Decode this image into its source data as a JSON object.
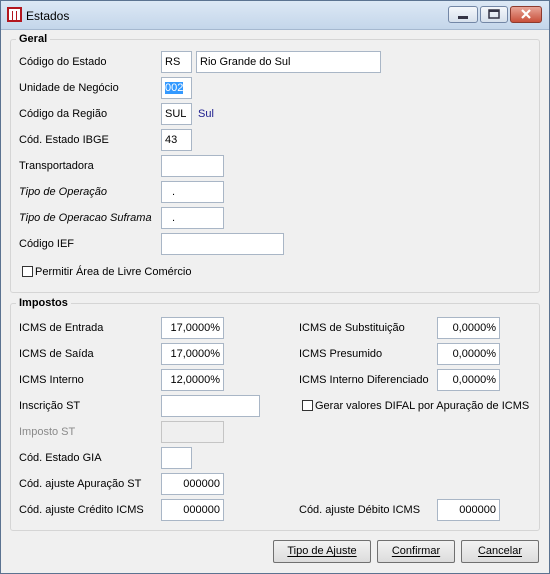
{
  "window": {
    "title": "Estados"
  },
  "geral": {
    "title": "Geral",
    "codigo_estado": {
      "label": "Código do Estado",
      "value": "RS",
      "name": "Rio Grande do Sul"
    },
    "unidade_negocio": {
      "label": "Unidade de Negócio",
      "value": "002"
    },
    "codigo_regiao": {
      "label": "Código da Região",
      "value": "SUL",
      "name": "Sul"
    },
    "cod_estado_ibge": {
      "label": "Cód. Estado IBGE",
      "value": "43"
    },
    "transportadora": {
      "label": "Transportadora",
      "value": ""
    },
    "tipo_operacao": {
      "label": "Tipo de Operação",
      "value": "."
    },
    "tipo_operacao_suframa": {
      "label": "Tipo de Operacao Suframa",
      "value": "."
    },
    "codigo_ief": {
      "label": "Código IEF",
      "value": ""
    },
    "livre_comercio": {
      "label": "Permitir Área de Livre Comércio",
      "checked": false
    }
  },
  "impostos": {
    "title": "Impostos",
    "icms_entrada": {
      "label": "ICMS de Entrada",
      "value": "17,0000%"
    },
    "icms_saida": {
      "label": "ICMS de Saída",
      "value": "17,0000%"
    },
    "icms_interno": {
      "label": "ICMS Interno",
      "value": "12,0000%"
    },
    "inscricao_st": {
      "label": "Inscrição ST",
      "value": ""
    },
    "imposto_st": {
      "label": "Imposto ST",
      "value": ""
    },
    "cod_estado_gia": {
      "label": "Cód. Estado GIA",
      "value": ""
    },
    "cod_ajuste_apuracao_st": {
      "label": "Cód. ajuste Apuração ST",
      "value": "000000"
    },
    "cod_ajuste_credito_icms": {
      "label": "Cód. ajuste Crédito ICMS",
      "value": "000000"
    },
    "icms_substituicao": {
      "label": "ICMS de Substituição",
      "value": "0,0000%"
    },
    "icms_presumido": {
      "label": "ICMS Presumido",
      "value": "0,0000%"
    },
    "icms_interno_diferenciado": {
      "label": "ICMS Interno Diferenciado",
      "value": "0,0000%"
    },
    "gerar_difal": {
      "label": "Gerar valores DIFAL por Apuração de ICMS",
      "checked": false
    },
    "cod_ajuste_debito_icms": {
      "label": "Cód. ajuste Débito ICMS",
      "value": "000000"
    }
  },
  "buttons": {
    "tipo_ajuste": "Tipo de Ajuste",
    "confirmar": "Confirmar",
    "cancelar": "Cancelar"
  },
  "colors": {
    "selection": "#3399ff",
    "close_button": "#c9503b",
    "link_text": "#1a1a8c"
  }
}
